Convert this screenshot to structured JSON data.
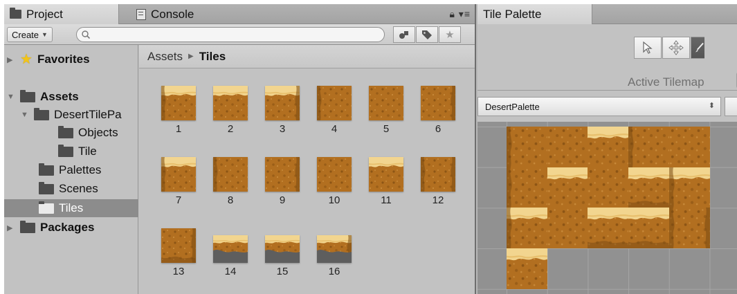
{
  "project_window": {
    "tabs": [
      {
        "label": "Project",
        "icon": "folder-icon",
        "active": true
      },
      {
        "label": "Console",
        "icon": "console-icon",
        "active": false
      }
    ],
    "toolbar": {
      "create_label": "Create",
      "search_placeholder": "",
      "search_icon": "magnifier-icon",
      "buttons": [
        "filter-by-type-icon",
        "filter-by-label-icon",
        "favorite-star-icon"
      ]
    },
    "tree": [
      {
        "label": "Favorites",
        "icon": "star-icon",
        "bold": true,
        "expanded": false,
        "depth": 0
      },
      {
        "label": "Assets",
        "icon": "folder-icon",
        "bold": true,
        "expanded": true,
        "depth": 0
      },
      {
        "label": "DesertTilePa",
        "icon": "folder-icon",
        "bold": false,
        "expanded": true,
        "depth": 1
      },
      {
        "label": "Objects",
        "icon": "folder-icon",
        "bold": false,
        "depth": 2
      },
      {
        "label": "Tile",
        "icon": "folder-icon",
        "bold": false,
        "depth": 2
      },
      {
        "label": "Palettes",
        "icon": "folder-icon",
        "bold": false,
        "depth": 1
      },
      {
        "label": "Scenes",
        "icon": "folder-icon",
        "bold": false,
        "depth": 1
      },
      {
        "label": "Tiles",
        "icon": "folder-icon",
        "bold": false,
        "depth": 1,
        "selected": true
      },
      {
        "label": "Packages",
        "icon": "folder-icon",
        "bold": true,
        "expanded": false,
        "depth": 0
      }
    ],
    "breadcrumb": {
      "parent": "Assets",
      "current": "Tiles"
    },
    "assets": [
      "1",
      "2",
      "3",
      "4",
      "5",
      "6",
      "7",
      "8",
      "9",
      "10",
      "11",
      "12",
      "13",
      "14",
      "15",
      "16"
    ]
  },
  "palette_window": {
    "tab_label": "Tile Palette",
    "tools": [
      "select-arrow-icon",
      "move-cross-icon",
      "brush-icon"
    ],
    "active_tilemap_label": "Active Tilemap",
    "palette_dropdown": "DesertPalette"
  },
  "colors": {
    "sand_top": "#f2d58f",
    "dirt": "#b06e1f",
    "dirt_dark": "#8d5515",
    "rock": "#5e5e5e",
    "selection": "#8c8c8c"
  }
}
